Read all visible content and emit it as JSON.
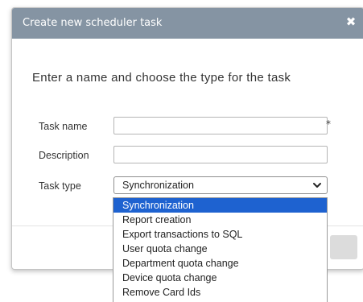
{
  "dialog": {
    "title": "Create new scheduler task",
    "close_icon": "close-icon",
    "heading": "Enter a name and choose the type for the task"
  },
  "form": {
    "task_name_label": "Task name",
    "task_name_value": "",
    "required_marker": "*",
    "description_label": "Description",
    "description_value": "",
    "task_type_label": "Task type",
    "task_type_selected": "Synchronization"
  },
  "dropdown": {
    "options": [
      "Synchronization",
      "Report creation",
      "Export transactions to SQL",
      "User quota change",
      "Department quota change",
      "Device quota change",
      "Remove Card Ids"
    ],
    "selected_index": 0
  },
  "colors": {
    "titlebar": "#8594a3",
    "selected_option": "#1e62d0"
  }
}
